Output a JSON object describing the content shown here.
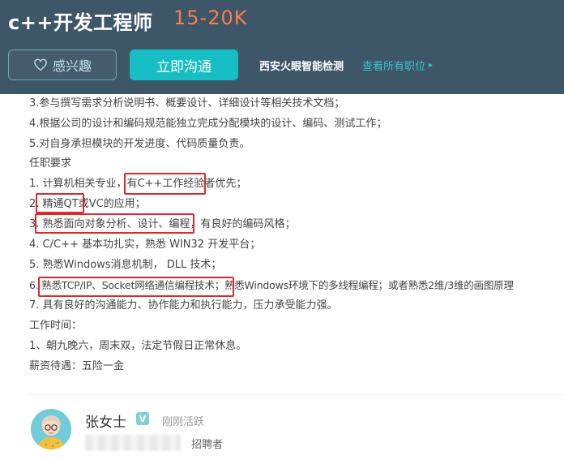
{
  "header": {
    "job_title": "c++开发工程师",
    "salary": "15-20K",
    "interest_label": "感兴趣",
    "chat_label": "立即沟通",
    "company": "西安火眼智能检测",
    "view_all_label": "查看所有职位",
    "icons": {
      "interest": "heart-icon",
      "view_all": "chevron-right-icon"
    }
  },
  "description": {
    "lines": [
      "3.参与撰写需求分析说明书、概要设计、详细设计等相关技术文档；",
      "4.根据公司的设计和编码规范能独立完成分配模块的设计、编码、测试工作；",
      "5.对自身承担模块的开发进度、代码质量负责。",
      "任职要求",
      "1. 计算机相关专业，有C++工作经验者优先；",
      "2. 精通QT或VC的应用；",
      "3. 熟悉面向对象分析、设计、编程，有良好的编码风格；",
      "4. C/C++ 基本功扎实，熟悉 WIN32 开发平台；",
      "5. 熟悉Windows消息机制， DLL 技术；",
      "6. 熟悉TCP/IP、Socket网络通信编程技术；熟悉Windows环境下的多线程编程；或者熟悉2维/3维的画图原理",
      "7. 具有良好的沟通能力、协作能力和执行能力，压力承受能力强。",
      "工作时间：",
      "1、朝九晚六，周末双，法定节假日正常休息。",
      "薪资待遇：五险一金"
    ],
    "highlight_color": "#e4262a"
  },
  "recruiter": {
    "name": "张女士",
    "verify_badge": "V",
    "status": "刚刚活跃",
    "role": "招聘者",
    "icons": {
      "avatar": "avatar-illustration",
      "verify": "verified-badge-icon"
    }
  },
  "colors": {
    "header_bg": "#3d5668",
    "salary": "#fb7c4f",
    "accent": "#17bfc4",
    "link": "#38c5ca"
  }
}
